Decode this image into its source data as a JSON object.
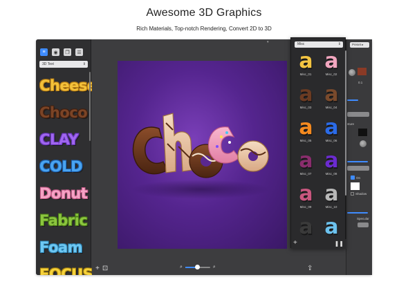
{
  "hero": {
    "title": "Awesome 3D Graphics",
    "subtitle": "Rich Materials, Top-notch Rendering, Convert 2D to 3D"
  },
  "left_panel": {
    "select_value": "3D Text",
    "styles": [
      {
        "label": "Cheese",
        "color": "#f3c13a",
        "outline": "#b87d14"
      },
      {
        "label": "Choco",
        "color": "#7b4426",
        "outline": "#3f1f10"
      },
      {
        "label": "CLAY",
        "color": "#a066ef",
        "outline": "#6232b4"
      },
      {
        "label": "COLD",
        "color": "#4aa4f0",
        "outline": "#1c60b0"
      },
      {
        "label": "Donut",
        "color": "#f5a3c4",
        "outline": "#c45a87"
      },
      {
        "label": "Fabric",
        "color": "#8cc63f",
        "outline": "#4d7f18"
      },
      {
        "label": "Foam",
        "color": "#6fc8f2",
        "outline": "#2e86b8"
      },
      {
        "label": "FOCUS",
        "color": "#f6d23a",
        "outline": "#a98410"
      }
    ]
  },
  "canvas": {
    "artwork_text": "Choco",
    "zoom_percent": 50
  },
  "material_popup": {
    "select_value": "Misc",
    "items": [
      {
        "name": "Misc_01",
        "color": "#f4c542"
      },
      {
        "name": "Misc_02",
        "color": "#f2a6bf"
      },
      {
        "name": "Misc_03",
        "color": "#6b3b22"
      },
      {
        "name": "Misc_04",
        "color": "#7a4a2c"
      },
      {
        "name": "Misc_05",
        "color": "#f58a1f"
      },
      {
        "name": "Misc_06",
        "color": "#2b6be8"
      },
      {
        "name": "Misc_07",
        "color": "#8a2d6d"
      },
      {
        "name": "Misc_08",
        "color": "#6b2bd0"
      },
      {
        "name": "Misc_09",
        "color": "#c9577f"
      },
      {
        "name": "Misc_10",
        "color": "#b8b8b8"
      },
      {
        "name": "",
        "color": "#3a3a3a"
      },
      {
        "name": "",
        "color": "#6cc2ee"
      }
    ]
  },
  "right_panel": {
    "preset_label": "Preset",
    "value_text": "0.1",
    "labels": [
      "sture",
      "On",
      "Shadow",
      "Specular"
    ]
  },
  "colors": {
    "window_bg": "#3d3d3f",
    "accent": "#3f8cff",
    "canvas_purple": "#55258f"
  }
}
